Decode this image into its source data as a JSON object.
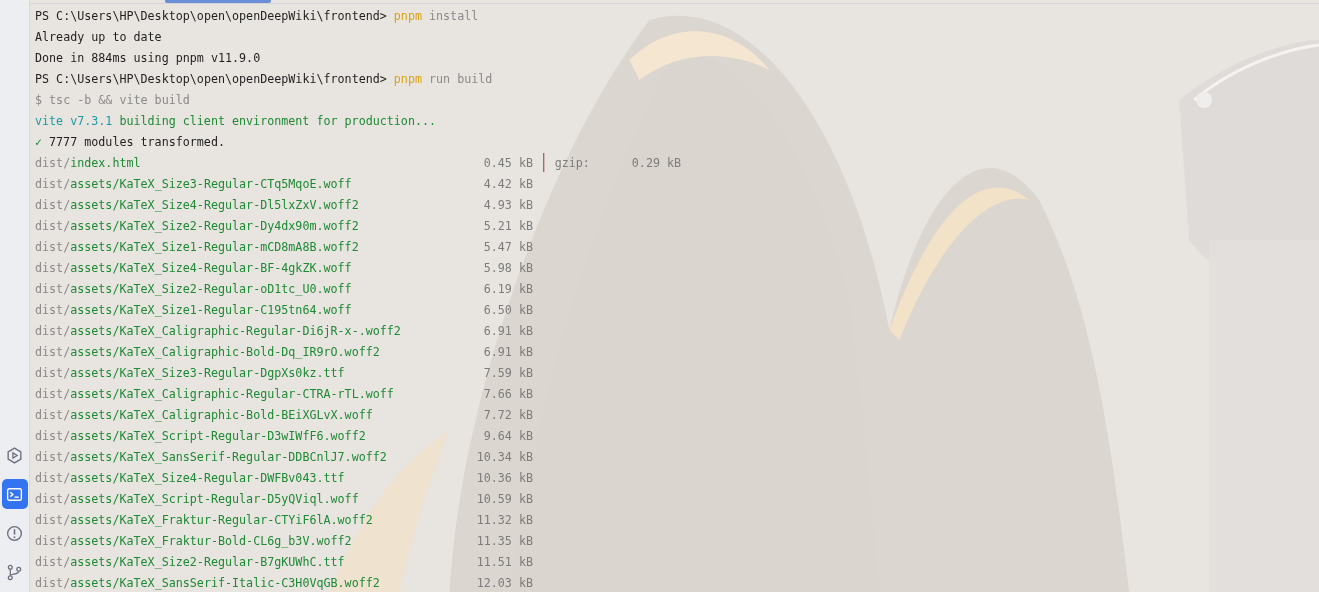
{
  "sidebar": {
    "items": [
      {
        "kind": "run",
        "selected": false
      },
      {
        "kind": "terminal",
        "selected": true
      },
      {
        "kind": "problems",
        "selected": false
      },
      {
        "kind": "git",
        "selected": false
      }
    ]
  },
  "terminal": {
    "lines": [
      {
        "kind": "prompt",
        "prompt": "PS C:\\Users\\HP\\Desktop\\open\\openDeepWiki\\frontend>",
        "command": "pnpm",
        "args": "install"
      },
      {
        "kind": "plain",
        "text": "Already up to date"
      },
      {
        "kind": "plain",
        "text": "Done in 884ms using pnpm v11.9.0"
      },
      {
        "kind": "prompt",
        "prompt": "PS C:\\Users\\HP\\Desktop\\open\\openDeepWiki\\frontend>",
        "command": "pnpm",
        "args": "run build"
      },
      {
        "kind": "muted",
        "text": "$ tsc -b && vite build"
      },
      {
        "kind": "vite",
        "tool": "vite v7.3.1",
        "text": "building client environment for production..."
      },
      {
        "kind": "success",
        "mark": "✓",
        "text": "7777 modules transformed."
      },
      {
        "kind": "file",
        "dir": "dist/",
        "path": "index.html",
        "size": "0.45 kB",
        "separator": "│",
        "gzip_label": "gzip:",
        "gzip_size": "0.29 kB"
      },
      {
        "kind": "file",
        "dir": "dist/",
        "path": "assets/KaTeX_Size3-Regular-CTq5MqoE.woff",
        "size": "4.42 kB"
      },
      {
        "kind": "file",
        "dir": "dist/",
        "path": "assets/KaTeX_Size4-Regular-Dl5lxZxV.woff2",
        "size": "4.93 kB"
      },
      {
        "kind": "file",
        "dir": "dist/",
        "path": "assets/KaTeX_Size2-Regular-Dy4dx90m.woff2",
        "size": "5.21 kB"
      },
      {
        "kind": "file",
        "dir": "dist/",
        "path": "assets/KaTeX_Size1-Regular-mCD8mA8B.woff2",
        "size": "5.47 kB"
      },
      {
        "kind": "file",
        "dir": "dist/",
        "path": "assets/KaTeX_Size4-Regular-BF-4gkZK.woff",
        "size": "5.98 kB"
      },
      {
        "kind": "file",
        "dir": "dist/",
        "path": "assets/KaTeX_Size2-Regular-oD1tc_U0.woff",
        "size": "6.19 kB"
      },
      {
        "kind": "file",
        "dir": "dist/",
        "path": "assets/KaTeX_Size1-Regular-C195tn64.woff",
        "size": "6.50 kB"
      },
      {
        "kind": "file",
        "dir": "dist/",
        "path": "assets/KaTeX_Caligraphic-Regular-Di6jR-x-.woff2",
        "size": "6.91 kB"
      },
      {
        "kind": "file",
        "dir": "dist/",
        "path": "assets/KaTeX_Caligraphic-Bold-Dq_IR9rO.woff2",
        "size": "6.91 kB"
      },
      {
        "kind": "file",
        "dir": "dist/",
        "path": "assets/KaTeX_Size3-Regular-DgpXs0kz.ttf",
        "size": "7.59 kB"
      },
      {
        "kind": "file",
        "dir": "dist/",
        "path": "assets/KaTeX_Caligraphic-Regular-CTRA-rTL.woff",
        "size": "7.66 kB"
      },
      {
        "kind": "file",
        "dir": "dist/",
        "path": "assets/KaTeX_Caligraphic-Bold-BEiXGLvX.woff",
        "size": "7.72 kB"
      },
      {
        "kind": "file",
        "dir": "dist/",
        "path": "assets/KaTeX_Script-Regular-D3wIWfF6.woff2",
        "size": "9.64 kB"
      },
      {
        "kind": "file",
        "dir": "dist/",
        "path": "assets/KaTeX_SansSerif-Regular-DDBCnlJ7.woff2",
        "size": "10.34 kB"
      },
      {
        "kind": "file",
        "dir": "dist/",
        "path": "assets/KaTeX_Size4-Regular-DWFBv043.ttf",
        "size": "10.36 kB"
      },
      {
        "kind": "file",
        "dir": "dist/",
        "path": "assets/KaTeX_Script-Regular-D5yQViql.woff",
        "size": "10.59 kB"
      },
      {
        "kind": "file",
        "dir": "dist/",
        "path": "assets/KaTeX_Fraktur-Regular-CTYiF6lA.woff2",
        "size": "11.32 kB"
      },
      {
        "kind": "file",
        "dir": "dist/",
        "path": "assets/KaTeX_Fraktur-Bold-CL6g_b3V.woff2",
        "size": "11.35 kB"
      },
      {
        "kind": "file",
        "dir": "dist/",
        "path": "assets/KaTeX_Size2-Regular-B7gKUWhC.ttf",
        "size": "11.51 kB"
      },
      {
        "kind": "file",
        "dir": "dist/",
        "path": "assets/KaTeX_SansSerif-Italic-C3H0VqGB.woff2",
        "size": "12.03 kB"
      }
    ]
  }
}
